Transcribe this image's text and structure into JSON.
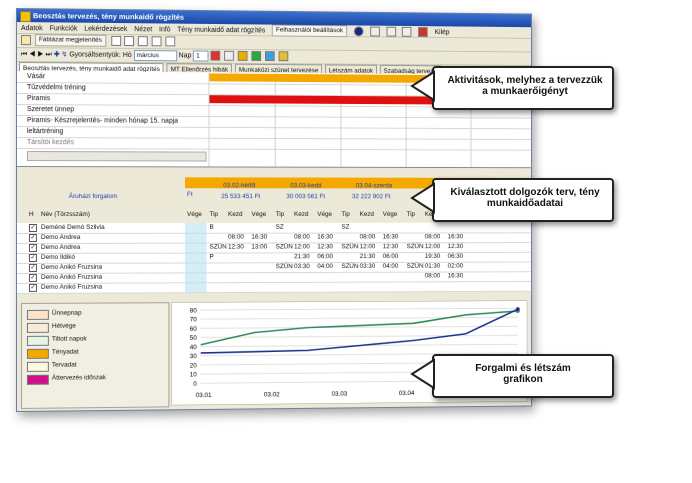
{
  "window": {
    "title": "Beosztás tervezés, tény munkaidő rögzítés"
  },
  "menu": [
    "Adatok",
    "Funkciók",
    "Lekérdezések",
    "Nézet",
    "Infó",
    "Tény munkaidő adat rögzítés"
  ],
  "toolbar": {
    "menu_shortcut": "Felhasználói beállítások",
    "help": "Kilép",
    "filter_btn": "Fáblázat megjelenítés",
    "schedule_label": "Gyorsáltsentyük:",
    "month_label": "Hó",
    "month_value": "március",
    "week_label": "Nap",
    "week_value": "1"
  },
  "tabs": [
    "Beosztás tervezés, tény munkaidő adat rögzítés",
    "MT Ellenőrzés hibák",
    "Munkaközi szünet tervezése",
    "Létszám adatok",
    "Szabadság tervezé"
  ],
  "activities": [
    "Vásár",
    "Tűzvédelmi tréning",
    "Piramis",
    "Szeretet ünnep",
    "Piramis- Készrejelentés- minden hónap 15. napja",
    "leltártréning",
    "Társítói kezdés"
  ],
  "grid": {
    "header_label": "Áruházi forgalom",
    "col_h": "H",
    "col_name": "Név (Törzsszám)",
    "days": [
      {
        "name": "03.02-hétfő",
        "amount": "25 533 451 Ft"
      },
      {
        "name": "03.03-kedd",
        "amount": "30 003 561 Ft"
      },
      {
        "name": "03.04-szerda",
        "amount": "32 222 902 Ft"
      }
    ],
    "sub_cols": [
      "Tip",
      "Kezd",
      "Vége"
    ],
    "prev_col": "Vége",
    "extra_top": "Ft",
    "rows": [
      {
        "name": "Deméné Demó Szilvia",
        "cells": [
          "B",
          "",
          "",
          "SZ",
          "",
          "",
          "SZ",
          "",
          "",
          "",
          "",
          ""
        ]
      },
      {
        "name": "Demo Andrea",
        "cells": [
          "",
          "08:00",
          "16:30",
          "",
          "08:00",
          "16:30",
          "",
          "08:00",
          "16:30",
          "",
          "08:00",
          "16:30"
        ]
      },
      {
        "name": "Demo Andrea",
        "cells": [
          "SZÜN",
          "12:30",
          "13:00",
          "SZÜN",
          "12:00",
          "12:30",
          "SZÜN",
          "12:00",
          "12:30",
          "SZÜN",
          "12:00",
          "12:30"
        ]
      },
      {
        "name": "Demo Ildikó",
        "cells": [
          "P",
          "",
          "",
          "",
          "21:30",
          "06:00",
          "",
          "21:30",
          "06:00",
          "",
          "19:30",
          "06:30"
        ]
      },
      {
        "name": "Demo Anikó Fruzsina",
        "cells": [
          "",
          "",
          "",
          "SZÜN",
          "03:30",
          "04:00",
          "SZÜN",
          "03:30",
          "04:00",
          "SZÜN",
          "01:30",
          "02:00"
        ]
      },
      {
        "name": "Demo Anikó Fruzsina",
        "cells": [
          "",
          "",
          "",
          "",
          "",
          "",
          "",
          "",
          "",
          "",
          "08:00",
          "16:30"
        ]
      },
      {
        "name": "Demo Anikó Fruzsina",
        "cells": [
          "",
          "",
          "",
          "",
          "",
          "",
          "",
          "",
          "",
          "",
          "",
          ""
        ]
      }
    ]
  },
  "legend": [
    {
      "label": "Ünnepnap",
      "color": "#fbe2c8"
    },
    {
      "label": "Hétvége",
      "color": "#f8ecd8"
    },
    {
      "label": "Tiltott napok",
      "color": "#e6f4e6"
    },
    {
      "label": "Tényadat",
      "color": "#f5a800"
    },
    {
      "label": "Tervadat",
      "color": "#fff8e0"
    },
    {
      "label": "Áttervezés időszak",
      "color": "#d0108a"
    }
  ],
  "callouts": {
    "top": "Aktivitások, melyhez a tervezzük a munkaerőigényt",
    "middle": "Kiválasztott dolgozók terv, tény munkaidőadatai",
    "bottom": "Forgalmi és létszám grafikon"
  },
  "chart_data": {
    "type": "line",
    "x": [
      "03.01",
      "03.02",
      "03.03",
      "03.04",
      "03.05",
      "03.06"
    ],
    "yticks": [
      0,
      10,
      20,
      30,
      40,
      50,
      60,
      70,
      80
    ],
    "ylim": [
      0,
      80
    ],
    "series": [
      {
        "color": "#2e8b57",
        "values": [
          42,
          55,
          60,
          62,
          64,
          73,
          77
        ]
      },
      {
        "color": "#1f2f8f",
        "values": [
          33,
          34,
          35,
          40,
          45,
          52,
          79
        ]
      }
    ]
  }
}
